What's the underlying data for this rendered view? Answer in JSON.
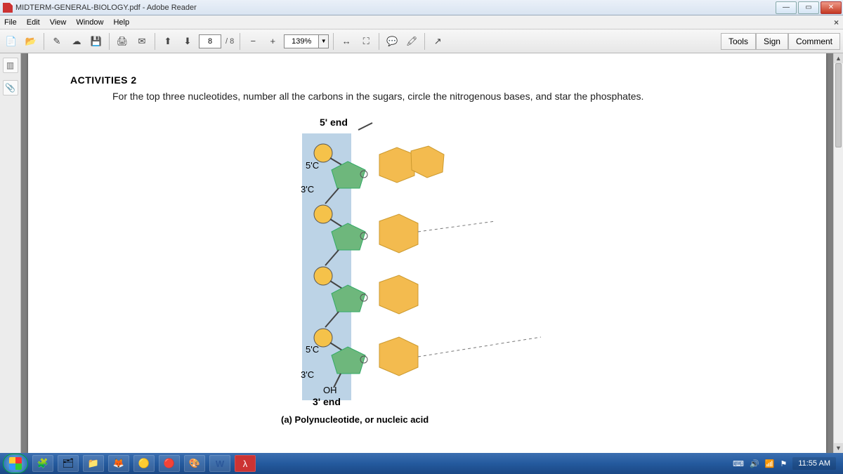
{
  "titlebar": {
    "title": "MIDTERM-GENERAL-BIOLOGY.pdf - Adobe Reader"
  },
  "menu": {
    "file": "File",
    "edit": "Edit",
    "view": "View",
    "window": "Window",
    "help": "Help"
  },
  "toolbar": {
    "page_current": "8",
    "page_total": "/ 8",
    "zoom": "139%",
    "panels": {
      "tools": "Tools",
      "sign": "Sign",
      "comment": "Comment"
    }
  },
  "doc": {
    "heading": "ACTIVITIES 2",
    "instruction": "For the top three nucleotides, number all the carbons in the sugars, circle the nitrogenous bases, and star the phosphates.",
    "diagram": {
      "label_5end": "5' end",
      "label_5c_a": "5'C",
      "label_3c_a": "3'C",
      "label_5c_b": "5'C",
      "label_3c_b": "3'C",
      "label_oh": "OH",
      "label_3end": "3' end",
      "caption": "(a) Polynucleotide, or nucleic acid"
    }
  },
  "taskbar": {
    "time": "11:55 AM"
  }
}
